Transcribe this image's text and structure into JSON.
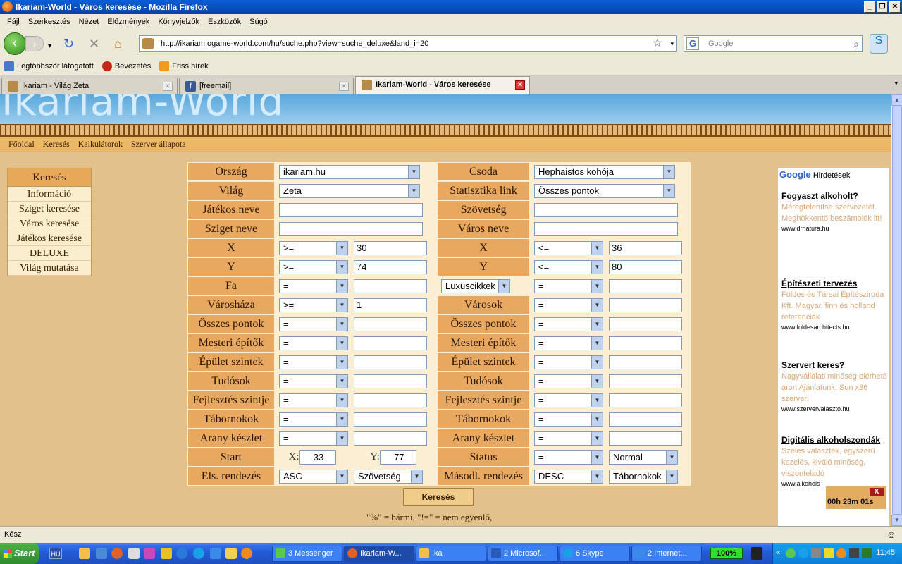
{
  "window": {
    "title": "Ikariam-World - Város keresése - Mozilla Firefox"
  },
  "menu": [
    "Fájl",
    "Szerkesztés",
    "Nézet",
    "Előzmények",
    "Könyvjelzők",
    "Eszközök",
    "Súgó"
  ],
  "nav": {
    "url": "http://ikariam.ogame-world.com/hu/suche.php?view=suche_deluxe&land_i=20",
    "search_placeholder": "Google"
  },
  "bookmarks": [
    "Legtöbbször látogatott",
    "Bevezetés",
    "Friss hírek"
  ],
  "tabs": [
    {
      "label": "Ikariam - Világ Zeta"
    },
    {
      "label": "[freemail]"
    },
    {
      "label": "Ikariam-World - Város keresése"
    }
  ],
  "page": {
    "logo": "Ikariam-World",
    "sitenav": [
      "Főoldal",
      "Keresés",
      "Kalkulátorok",
      "Szerver állapota"
    ],
    "leftmenu": {
      "header": "Keresés",
      "items": [
        "Információ",
        "Sziget keresése",
        "Város keresése",
        "Játékos keresése",
        "DELUXE",
        "Világ mutatása"
      ]
    },
    "form": {
      "orszag": {
        "label": "Ország",
        "value": "ikariam.hu"
      },
      "csoda": {
        "label": "Csoda",
        "value": "Hephaistos kohója"
      },
      "vilag": {
        "label": "Világ",
        "value": "Zeta"
      },
      "statlink": {
        "label": "Statisztika link",
        "value": "Összes pontok"
      },
      "jatekos": {
        "label": "Játékos neve",
        "value": ""
      },
      "szovetseg": {
        "label": "Szövetség",
        "value": ""
      },
      "sziget": {
        "label": "Sziget neve",
        "value": ""
      },
      "varos": {
        "label": "Város neve",
        "value": ""
      },
      "rows": [
        {
          "left": "X",
          "lop": ">=",
          "lval": "30",
          "right": "X",
          "rop": "<=",
          "rval": "36"
        },
        {
          "left": "Y",
          "lop": ">=",
          "lval": "74",
          "right": "Y",
          "rop": "<=",
          "rval": "80"
        },
        {
          "left": "Fa",
          "lop": "=",
          "lval": "",
          "right": "Luxuscikkek",
          "rop": "=",
          "rval": ""
        },
        {
          "left": "Városháza",
          "lop": ">=",
          "lval": "1",
          "right": "Városok",
          "rop": "=",
          "rval": ""
        },
        {
          "left": "Összes pontok",
          "lop": "=",
          "lval": "",
          "right": "Összes pontok",
          "rop": "=",
          "rval": ""
        },
        {
          "left": "Mesteri építők",
          "lop": "=",
          "lval": "",
          "right": "Mesteri építők",
          "rop": "=",
          "rval": ""
        },
        {
          "left": "Épület szintek",
          "lop": "=",
          "lval": "",
          "right": "Épület szintek",
          "rop": "=",
          "rval": ""
        },
        {
          "left": "Tudósok",
          "lop": "=",
          "lval": "",
          "right": "Tudósok",
          "rop": "=",
          "rval": ""
        },
        {
          "left": "Fejlesztés szintje",
          "lop": "=",
          "lval": "",
          "right": "Fejlesztés szintje",
          "rop": "=",
          "rval": ""
        },
        {
          "left": "Tábornokok",
          "lop": "=",
          "lval": "",
          "right": "Tábornokok",
          "rop": "=",
          "rval": ""
        },
        {
          "left": "Arany készlet",
          "lop": "=",
          "lval": "",
          "right": "Arany készlet",
          "rop": "=",
          "rval": ""
        }
      ],
      "start": {
        "label": "Start",
        "x_label": "X:",
        "x": "33",
        "y_label": "Y:",
        "y": "77"
      },
      "status": {
        "label": "Status",
        "op": "=",
        "value": "Normal"
      },
      "sort1": {
        "label": "Els. rendezés",
        "dir": "ASC",
        "field": "Szövetség"
      },
      "sort2": {
        "label": "Másodl. rendezés",
        "dir": "DESC",
        "field": "Tábornokok"
      },
      "submit": "Keresés",
      "hint": "\"%\" = bármi, \"!=\" = nem egyenlő,"
    },
    "ads": {
      "header_google": "Google",
      "header_label": "Hirdetések",
      "items": [
        {
          "title": "Fogyaszt alkoholt?",
          "body": "Méregtelenítse szervezetét. Meghökkentő beszámolók itt!",
          "url": "www.drnatura.hu"
        },
        {
          "title": "Építészeti tervezés",
          "body": "Földes és Társai Építésziroda Kft. Magyar, finn és holland referenciák",
          "url": "www.foldesarchitects.hu"
        },
        {
          "title": "Szervert keres?",
          "body": "Nagyvállalati minőség elérhető áron Ajánlatunk: Sun x86 szerver!",
          "url": "www.szervervalaszto.hu"
        },
        {
          "title": "Digitális alkoholszondák",
          "body": "Széles választék, egyszerű kezelés, kiváló minőség, viszonteladó",
          "url": "www.alkohols"
        }
      ]
    },
    "timer": {
      "close": "X",
      "time": "00h 23m 01s"
    }
  },
  "status_text": "Kész",
  "taskbar": {
    "start": "Start",
    "lang": "HU",
    "tasks": [
      "3 Messenger",
      "Ikariam-W...",
      "Ika",
      "2 Microsof...",
      "6 Skype",
      "2 Internet..."
    ],
    "battery": "100%",
    "clock": "11:45"
  }
}
